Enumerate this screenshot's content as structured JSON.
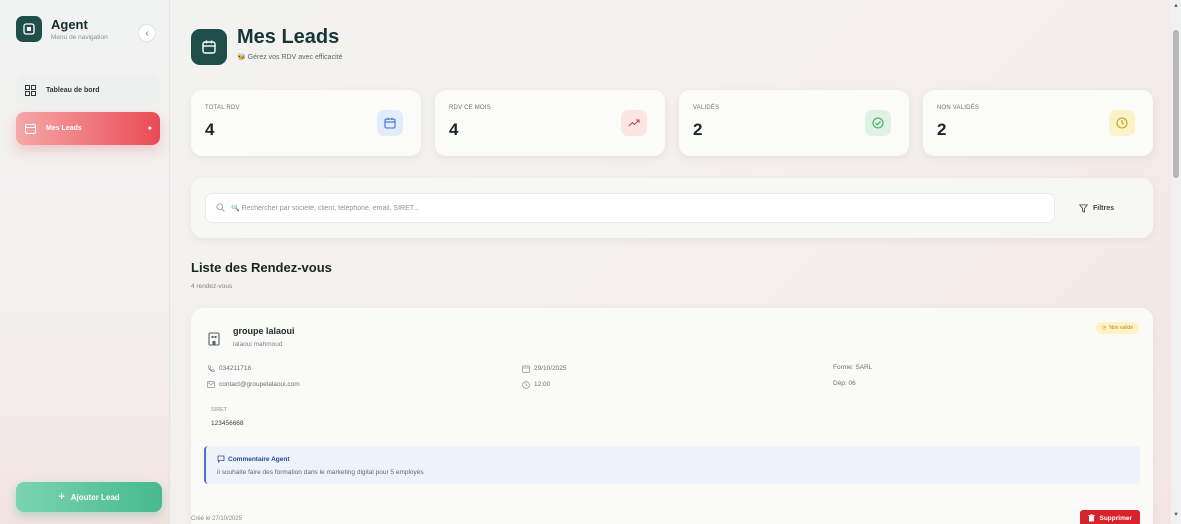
{
  "sidebar": {
    "brand_title": "Agent",
    "brand_subtitle": "Menu de navigation",
    "collapse_glyph": "‹",
    "items": [
      {
        "label": "Tableau de bord",
        "icon": "grid-icon"
      },
      {
        "label": "Mes Leads",
        "icon": "calendar-icon",
        "active": true
      }
    ],
    "add_lead_label": "Ajouter Lead"
  },
  "header": {
    "title": "Mes Leads",
    "subtitle": "🐝 Gérez vos RDV avec efficacité"
  },
  "stats": [
    {
      "label": "TOTAL RDV",
      "value": "4",
      "icon": "calendar-icon",
      "icon_bg": "#e3ecfb",
      "icon_color": "#3d6fd1"
    },
    {
      "label": "RDV CE MOIS",
      "value": "4",
      "icon": "trend-up-icon",
      "icon_bg": "#fbe6e4",
      "icon_color": "#c44a4a"
    },
    {
      "label": "VALIDÉS",
      "value": "2",
      "icon": "check-circle-icon",
      "icon_bg": "#dff3e5",
      "icon_color": "#3caa64"
    },
    {
      "label": "NON VALIDÉS",
      "value": "2",
      "icon": "clock-icon",
      "icon_bg": "#fbf3c8",
      "icon_color": "#c4a01a"
    }
  ],
  "search": {
    "placeholder": "🔍 Rechercher par société, client, téléphone, email, SIRET...",
    "value": "",
    "filter_label": "Filtres"
  },
  "list": {
    "title": "Liste des Rendez-vous",
    "count_text": "4 rendez-vous"
  },
  "lead": {
    "company": "groupe lalaoui",
    "contact": "lalaoui mahmoud",
    "status": "Non validé",
    "phone": "034211718",
    "email": "contact@groupelalaoui.com",
    "date": "29/10/2025",
    "time": "12:00",
    "legal_form": "Forme: SARL",
    "department": "Dép: 06",
    "siret_label": "SIRET",
    "siret": "123456668",
    "comment_title": "Commentaire Agent",
    "comment_text": "il souhaite faire des formation dans le marketing digital pour 5 employés",
    "created": "Créé le 27/10/2025",
    "delete_label": "Supprimer"
  },
  "colors": {
    "brand": "#1f4d4a",
    "active_nav": "#ea4b55",
    "add_button": "#48b98f",
    "delete": "#d6232e"
  }
}
